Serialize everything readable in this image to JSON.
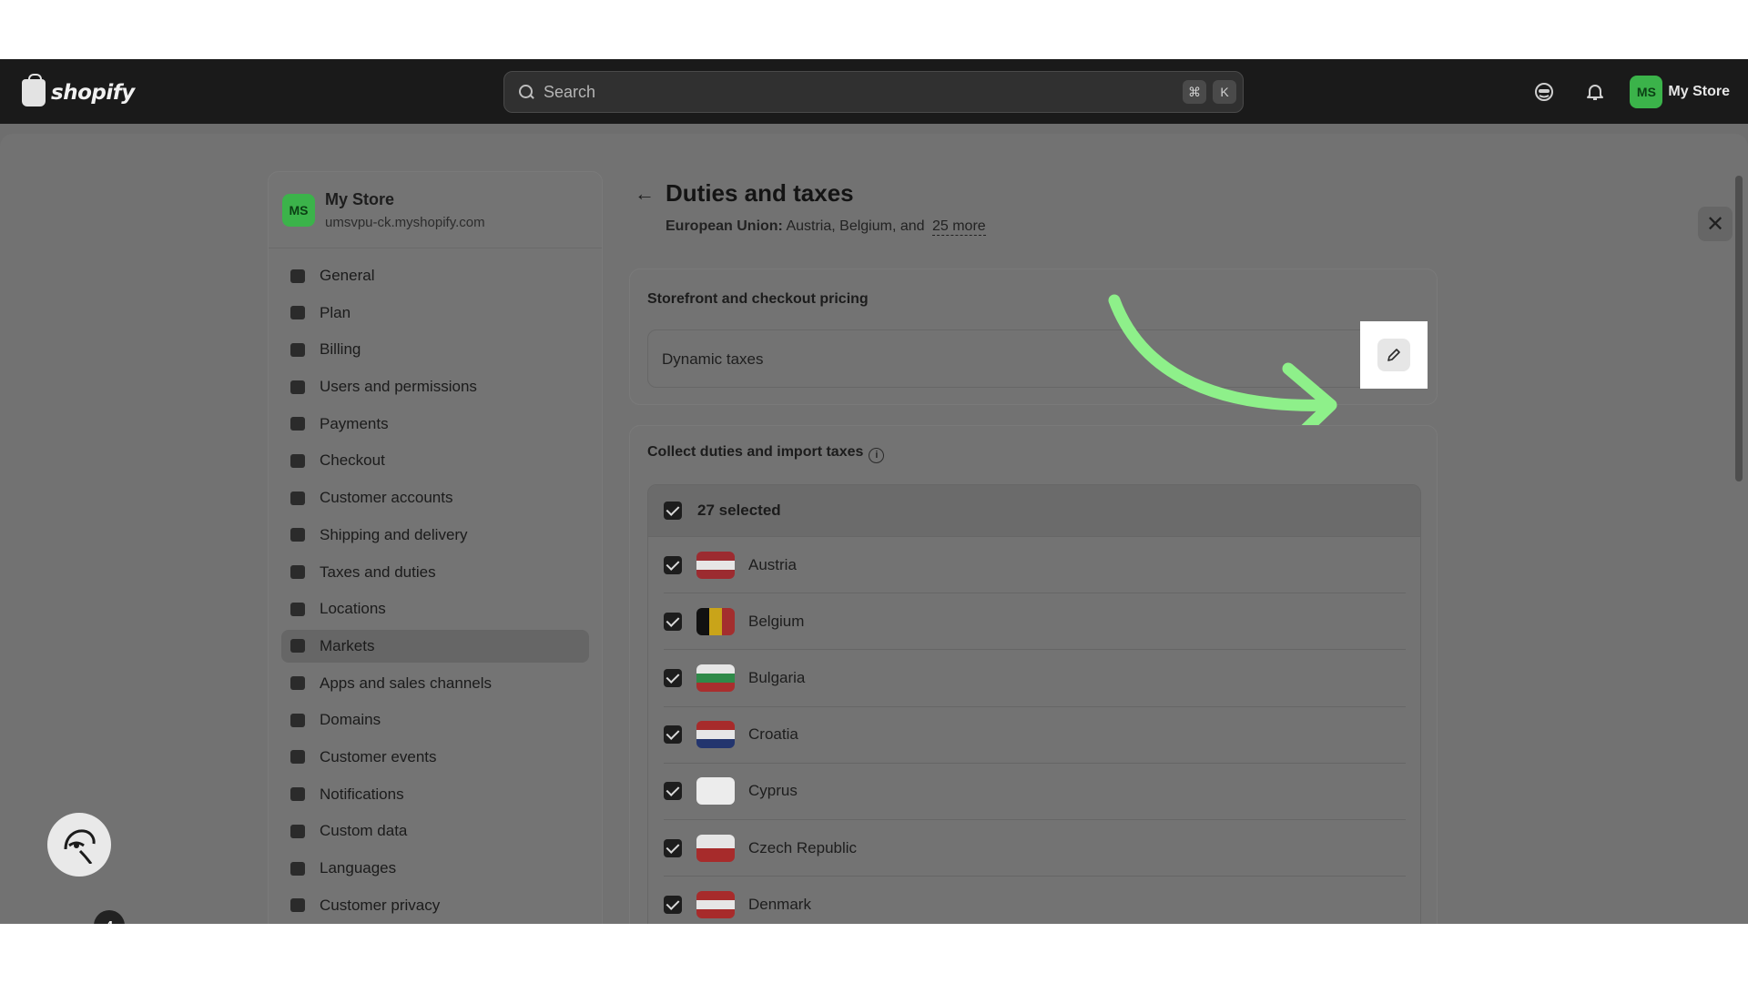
{
  "topbar": {
    "brand": "shopify",
    "search_placeholder": "Search",
    "shortcut_key1": "⌘",
    "shortcut_key2": "K",
    "store_initials": "MS",
    "store_name": "My Store"
  },
  "sidebar": {
    "store_initials": "MS",
    "store_name": "My Store",
    "store_url": "umsvpu-ck.myshopify.com",
    "items": [
      {
        "label": "General",
        "icon": "store-icon"
      },
      {
        "label": "Plan",
        "icon": "plan-icon"
      },
      {
        "label": "Billing",
        "icon": "billing-icon"
      },
      {
        "label": "Users and permissions",
        "icon": "users-icon"
      },
      {
        "label": "Payments",
        "icon": "payments-icon"
      },
      {
        "label": "Checkout",
        "icon": "cart-icon"
      },
      {
        "label": "Customer accounts",
        "icon": "person-icon"
      },
      {
        "label": "Shipping and delivery",
        "icon": "truck-icon"
      },
      {
        "label": "Taxes and duties",
        "icon": "taxes-icon"
      },
      {
        "label": "Locations",
        "icon": "location-icon"
      },
      {
        "label": "Markets",
        "icon": "globe-icon",
        "active": true
      },
      {
        "label": "Apps and sales channels",
        "icon": "apps-icon"
      },
      {
        "label": "Domains",
        "icon": "domains-icon"
      },
      {
        "label": "Customer events",
        "icon": "events-icon"
      },
      {
        "label": "Notifications",
        "icon": "bell-icon"
      },
      {
        "label": "Custom data",
        "icon": "data-icon"
      },
      {
        "label": "Languages",
        "icon": "languages-icon"
      },
      {
        "label": "Customer privacy",
        "icon": "lock-icon"
      }
    ]
  },
  "main": {
    "title": "Duties and taxes",
    "subtitle_region": "European Union:",
    "subtitle_countries": " Austria, Belgium, and",
    "subtitle_more": "25 more",
    "pricing_card": {
      "title": "Storefront and checkout pricing",
      "option_label": "Dynamic taxes"
    },
    "duties_card": {
      "title": "Collect duties and import taxes",
      "selected_label": "27 selected",
      "countries": [
        {
          "name": "Austria",
          "flag": "austria-flag-icon"
        },
        {
          "name": "Belgium",
          "flag": "belgium-flag-icon"
        },
        {
          "name": "Bulgaria",
          "flag": "bulgaria-flag-icon"
        },
        {
          "name": "Croatia",
          "flag": "croatia-flag-icon"
        },
        {
          "name": "Cyprus",
          "flag": "cyprus-flag-icon"
        },
        {
          "name": "Czech Republic",
          "flag": "czech-flag-icon"
        },
        {
          "name": "Denmark",
          "flag": "denmark-flag-icon"
        }
      ]
    }
  },
  "helper_badge_count": "4",
  "colors": {
    "accent_green": "#8ef08a",
    "avatar_green": "#3bb34a",
    "topbar_bg": "#1a1a1a"
  }
}
